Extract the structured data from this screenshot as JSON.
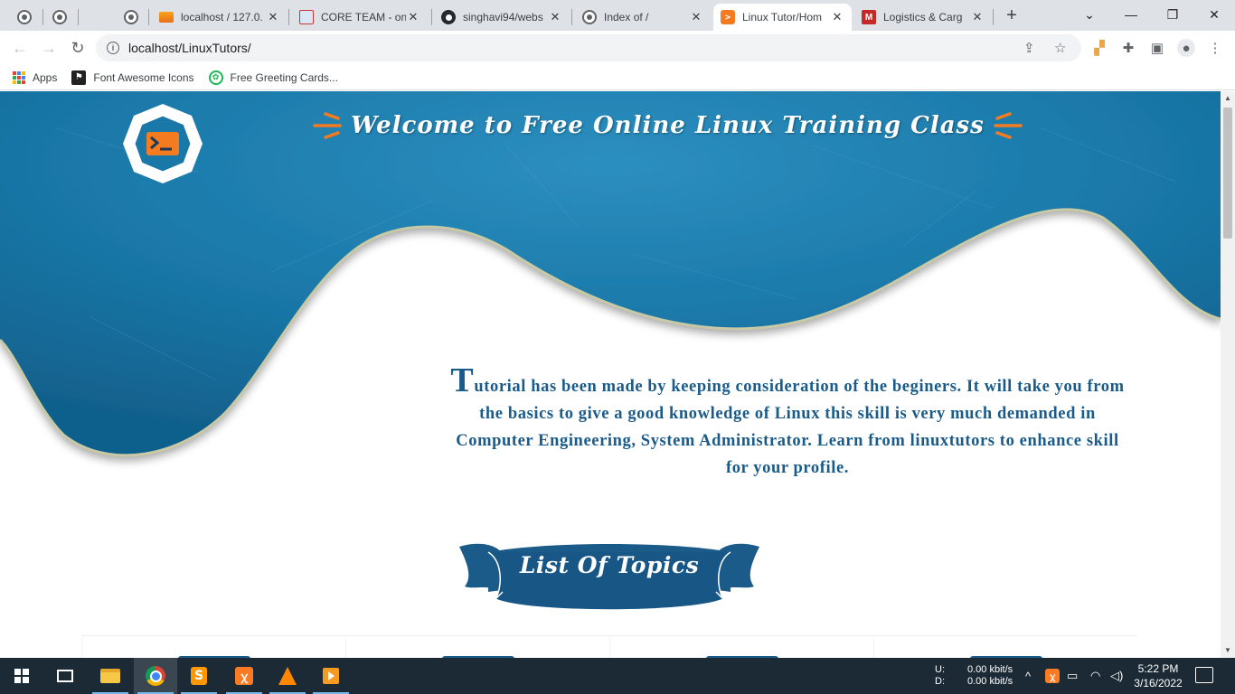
{
  "browser": {
    "tabs": [
      {
        "title": "",
        "favicon": "globe-icon",
        "pinned": true
      },
      {
        "title": "",
        "favicon": "globe-icon",
        "pinned": true
      },
      {
        "title": "",
        "favicon": "globe-icon",
        "pinned": true
      },
      {
        "title": "localhost / 127.0.",
        "favicon": "phpmyadmin-icon"
      },
      {
        "title": "CORE TEAM - onl",
        "favicon": "core-team-icon"
      },
      {
        "title": "singhavi94/webs",
        "favicon": "github-icon"
      },
      {
        "title": "Index of /",
        "favicon": "globe-icon"
      },
      {
        "title": "Linux Tutor/Hom",
        "favicon": "terminal-icon",
        "active": true
      },
      {
        "title": "Logistics & Carg",
        "favicon": "logistics-icon"
      }
    ],
    "tab_close_glyph": "✕",
    "new_tab_glyph": "+",
    "window_controls": {
      "collapse": "⌄",
      "minimize": "—",
      "restore": "❐",
      "close": "✕"
    },
    "url": "localhost/LinuxTutors/",
    "bookmarks": [
      {
        "label": "Apps",
        "icon": "apps-grid-icon"
      },
      {
        "label": "Font Awesome Icons",
        "icon": "font-awesome-icon"
      },
      {
        "label": "Free Greeting Cards...",
        "icon": "greeting-cards-icon"
      }
    ]
  },
  "page": {
    "header_title": "Welcome to Free Online Linux Training Class",
    "intro_dropcap": "T",
    "intro_text": "utorial has been made by keeping consideration of the beginers. It will take you from the basics to give a good knowledge of Linux this skill is very much demanded in Computer Engineering, System Administrator. Learn from linuxtutors to enhance skill for your profile.",
    "topics_heading": "List Of Topics",
    "colors": {
      "accent": "#1a5b8a",
      "orange": "#f47b20",
      "hero_blue": "#1a7fb0"
    }
  },
  "taskbar": {
    "apps": [
      "windows-start",
      "task-view",
      "file-explorer",
      "chrome",
      "sublime-text",
      "xampp",
      "vlc",
      "media-player"
    ],
    "net_up_label": "U:",
    "net_down_label": "D:",
    "net_up": "0.00 kbit/s",
    "net_down": "0.00 kbit/s",
    "time": "5:22 PM",
    "date": "3/16/2022"
  }
}
